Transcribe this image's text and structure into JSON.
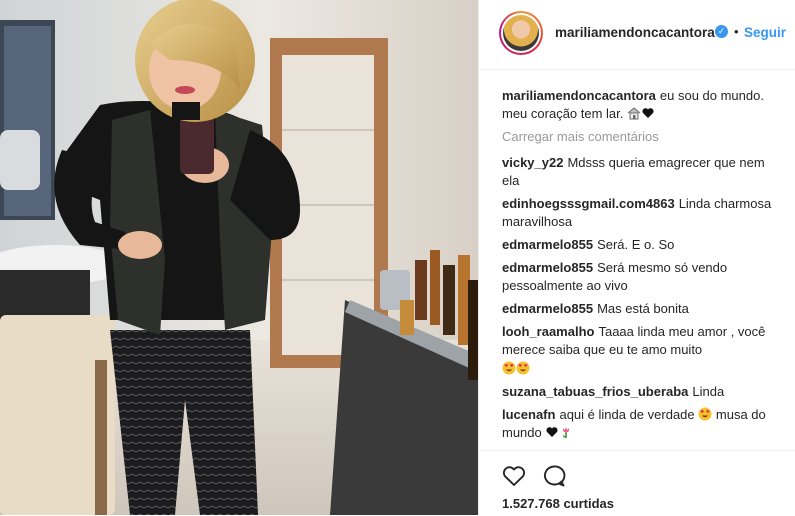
{
  "post": {
    "username": "mariliamendoncacantora",
    "follow_label": "Seguir",
    "separator": "•",
    "caption_text": "eu sou do mundo. meu coração tem lar.",
    "load_more_label": "Carregar mais comentários",
    "likes_text": "1.527.768 curtidas"
  },
  "comments": [
    {
      "user": "vicky_y22",
      "text": "Mdsss queria emagrecer que nem ela"
    },
    {
      "user": "edinhoegsssgmail.com4863",
      "text": "Linda charmosa maravilhosa"
    },
    {
      "user": "edmarmelo855",
      "text": "Será. E o. So"
    },
    {
      "user": "edmarmelo855",
      "text": "Será mesmo só vendo pessoalmente ao vivo"
    },
    {
      "user": "edmarmelo855",
      "text": "Mas está bonita"
    },
    {
      "user": "looh_raamalho",
      "text": "Taaaa linda meu amor , você merece saiba que eu te amo muito"
    },
    {
      "user": "suzana_tabuas_frios_uberaba",
      "text": "Linda"
    },
    {
      "user": "lucenafn",
      "text": "aqui é linda de verdade",
      "text_after": "musa do mundo"
    }
  ],
  "icons": {
    "verified": "verified-badge-icon",
    "like": "heart-outline-icon",
    "comment": "speech-bubble-icon",
    "caption_emojis": [
      "house-emoji-icon",
      "black-heart-icon"
    ],
    "love_emojis": [
      "heart-eyes-emoji-icon",
      "heart-eyes-emoji-icon"
    ],
    "lucena_emojis": [
      "heart-eyes-emoji-icon",
      "black-heart-icon",
      "tulip-emoji-icon"
    ]
  },
  "colors": {
    "link_blue": "#3897f0",
    "muted_text": "#999999",
    "text": "#262626",
    "divider": "#efefef"
  }
}
